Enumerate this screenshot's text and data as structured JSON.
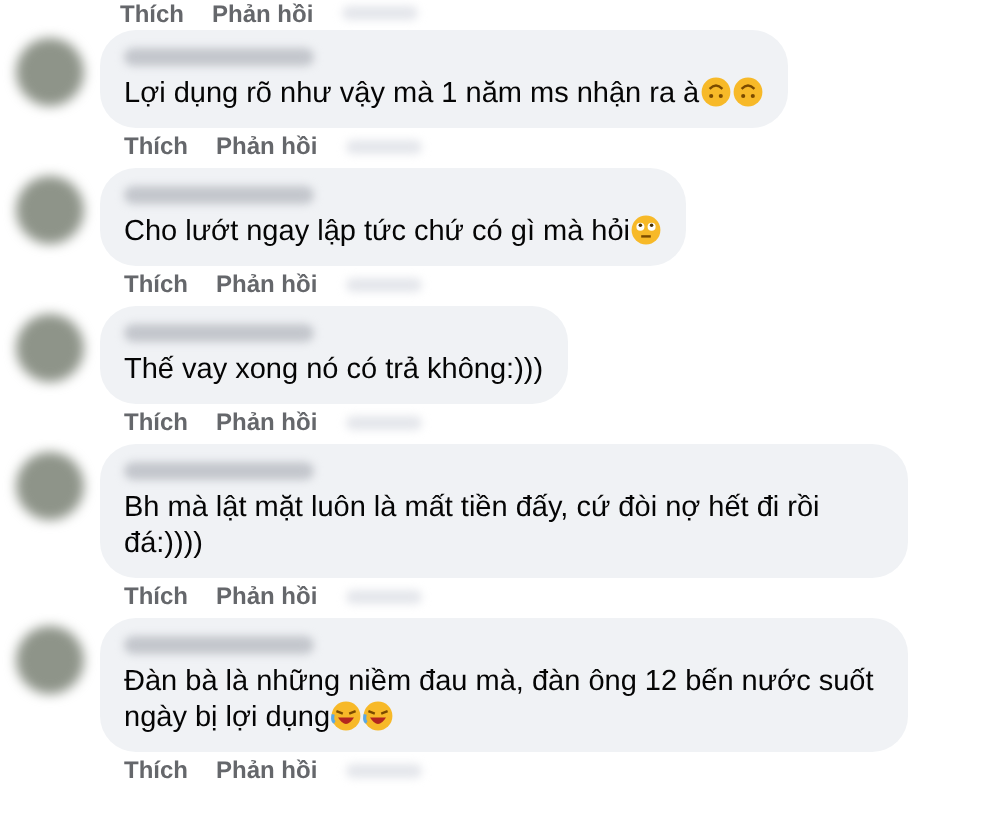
{
  "top_actions": {
    "like": "Thích",
    "reply": "Phản hồi"
  },
  "comments": [
    {
      "text": "Lợi dụng rõ như vậy mà 1 năm ms nhận ra à",
      "emojis": [
        {
          "kind": "upside_down"
        },
        {
          "kind": "upside_down"
        }
      ],
      "like": "Thích",
      "reply": "Phản hồi"
    },
    {
      "text": "Cho lướt ngay lập tức chứ có gì mà hỏi",
      "emojis": [
        {
          "kind": "eye_roll"
        }
      ],
      "like": "Thích",
      "reply": "Phản hồi"
    },
    {
      "text": "Thế vay xong nó có trả không:)))",
      "like": "Thích",
      "reply": "Phản hồi"
    },
    {
      "text": "Bh mà lật mặt luôn là mất tiền đấy, cứ đòi nợ hết đi rồi đá:))))",
      "like": "Thích",
      "reply": "Phản hồi"
    },
    {
      "text": "Đàn bà là những niềm đau mà, đàn ông 12 bến nước suốt ngày bị lợi dụng",
      "emojis": [
        {
          "kind": "laughing"
        },
        {
          "kind": "laughing"
        }
      ],
      "like": "Thích",
      "reply": "Phản hồi"
    }
  ]
}
